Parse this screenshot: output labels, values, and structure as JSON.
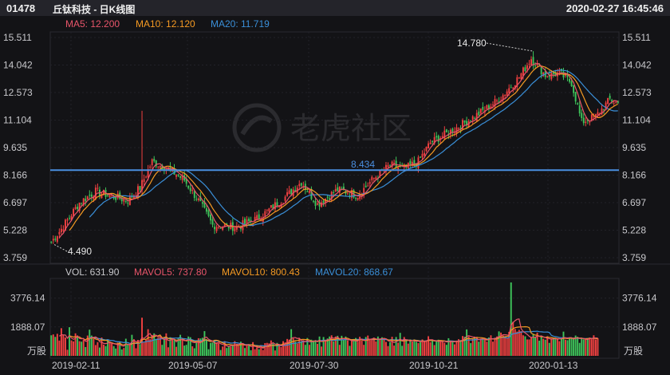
{
  "header": {
    "code": "01478",
    "name": "丘钛科技 - 日K线图",
    "datetime": "2020-02-27 16:45:46"
  },
  "watermark": {
    "text": "老虎社区"
  },
  "price_legend": {
    "ma5": "MA5: 12.200",
    "ma10": "MA10: 12.120",
    "ma20": "MA20: 11.719"
  },
  "volume_legend": {
    "vol": "VOL: 631.90",
    "mavol5": "MAVOL5: 737.80",
    "mavol10": "MAVOL10: 800.43",
    "mavol20": "MAVOL20: 868.67"
  },
  "volume_unit": "万股",
  "colors": {
    "up": "#f04040",
    "down": "#3ec45a",
    "ma5": "#e8556a",
    "ma10": "#f59a23",
    "ma20": "#3a8fd8",
    "hline": "#4a8fe0",
    "text": "#c8c8cc"
  },
  "chart_data": [
    {
      "type": "candlestick",
      "price_ticks": [
        "15.511",
        "14.042",
        "12.573",
        "11.104",
        "9.635",
        "8.166",
        "6.697",
        "5.228",
        "3.759"
      ],
      "ylim": [
        3.759,
        15.511
      ],
      "x_ticks": [
        "2019-02-11",
        "2019-05-07",
        "2019-07-30",
        "2019-10-21",
        "2020-01-13"
      ],
      "annotations": {
        "high": "14.780",
        "low": "4.490",
        "mid": "8.434"
      },
      "horizontal_line": 8.434,
      "anchors": [
        {
          "i": 0,
          "p": 4.6
        },
        {
          "i": 5,
          "p": 5.3
        },
        {
          "i": 14,
          "p": 6.7
        },
        {
          "i": 22,
          "p": 7.3
        },
        {
          "i": 38,
          "p": 6.8
        },
        {
          "i": 44,
          "p": 7.5
        },
        {
          "i": 50,
          "p": 8.9
        },
        {
          "i": 58,
          "p": 8.5
        },
        {
          "i": 66,
          "p": 7.9
        },
        {
          "i": 73,
          "p": 6.8
        },
        {
          "i": 80,
          "p": 5.5
        },
        {
          "i": 92,
          "p": 5.4
        },
        {
          "i": 103,
          "p": 5.9
        },
        {
          "i": 115,
          "p": 6.9
        },
        {
          "i": 124,
          "p": 7.8
        },
        {
          "i": 132,
          "p": 6.6
        },
        {
          "i": 142,
          "p": 7.4
        },
        {
          "i": 152,
          "p": 7.1
        },
        {
          "i": 160,
          "p": 8.0
        },
        {
          "i": 168,
          "p": 8.7
        },
        {
          "i": 175,
          "p": 8.5
        },
        {
          "i": 182,
          "p": 8.9
        },
        {
          "i": 188,
          "p": 9.9
        },
        {
          "i": 198,
          "p": 10.5
        },
        {
          "i": 210,
          "p": 11.3
        },
        {
          "i": 222,
          "p": 12.2
        },
        {
          "i": 232,
          "p": 13.4
        },
        {
          "i": 238,
          "p": 14.4
        },
        {
          "i": 245,
          "p": 13.5
        },
        {
          "i": 252,
          "p": 13.6
        },
        {
          "i": 258,
          "p": 13.1
        },
        {
          "i": 263,
          "p": 11.0
        },
        {
          "i": 270,
          "p": 11.3
        },
        {
          "i": 277,
          "p": 12.2
        },
        {
          "i": 281,
          "p": 12.0
        }
      ],
      "spikes": [
        {
          "i": 45,
          "high": 11.6
        },
        {
          "i": 239,
          "high": 14.78
        },
        {
          "i": 1,
          "low": 4.49
        }
      ]
    },
    {
      "type": "bar",
      "ticks": [
        "3776.14",
        "1888.07"
      ],
      "ylim": [
        0,
        4800
      ],
      "values": [
        1344,
        1400,
        1240,
        1440,
        1000,
        1808,
        1360,
        1200,
        400,
        1872,
        1008,
        944,
        1472,
        1264,
        960,
        928,
        1056,
        576,
        1328,
        1712,
        1328,
        1120,
        704,
        896,
        544,
        1200,
        736,
        640,
        1024,
        896,
        784,
        640,
        480,
        864,
        912,
        416,
        512,
        1120,
        800,
        784,
        1376,
        1088,
        496,
        1040,
        768,
        2496,
        880,
        1056,
        1744,
        1088,
        1360,
        1472,
        1104,
        1184,
        1216,
        720,
        1072,
        1472,
        560,
        1216,
        1152,
        1072,
        592,
        1152,
        1376,
        1168,
        672,
        720,
        1264,
        1216,
        624,
        496,
        864,
        1152,
        1136,
        1184,
        1616,
        1024,
        432,
        848,
        880,
        1024,
        880,
        832,
        384,
        608,
        960,
        512,
        624,
        608,
        704,
        960,
        784,
        640,
        928,
        736,
        512,
        720,
        688,
        368,
        896,
        432,
        560,
        432,
        704,
        384,
        832,
        848,
        816,
        1008,
        800,
        352,
        848,
        720,
        576,
        960,
        880,
        1104,
        1056,
        1744,
        1152,
        928,
        800,
        1152,
        944,
        1024,
        720,
        1168,
        720,
        1056,
        1008,
        1024,
        784,
        1264,
        608,
        1232,
        1024,
        1136,
        1264,
        1344,
        944,
        1264,
        1312,
        720,
        1312,
        1024,
        1264,
        1008,
        656,
        976,
        1104,
        1168,
        928,
        1248,
        992,
        720,
        1232,
        1328,
        1072,
        1136,
        1056,
        944,
        1264,
        1120,
        1216,
        1072,
        912,
        640,
        896,
        1248,
        672,
        1232,
        864,
        1504,
        656,
        1232,
        1008,
        800,
        1072,
        944,
        1072,
        912,
        832,
        896,
        1072,
        992,
        1024,
        1280,
        896,
        1072,
        704,
        960,
        1056,
        1024,
        896,
        864,
        720,
        1152,
        1008,
        960,
        752,
        960,
        1088,
        1040,
        1296,
        1248,
        1728,
        1264,
        832,
        1120,
        1184,
        1232,
        928,
        1056,
        1136,
        1072,
        928,
        1200,
        1344,
        928,
        1184,
        1264,
        1600,
        1520,
        1328,
        1200,
        1152,
        1568,
        4800,
        2224,
        1760,
        1584,
        1696,
        1616,
        1344,
        1280,
        1072,
        1072,
        1232,
        1440,
        1232,
        1520,
        992,
        1328,
        1120,
        1056,
        1280,
        848,
        1136,
        1200,
        1136,
        1152,
        960,
        1152,
        1584,
        1056,
        1024,
        1120,
        1152,
        1104,
        1328,
        1248,
        848,
        1184,
        1072,
        1104,
        1136,
        1200,
        1088,
        1344,
        1072,
        1152
      ]
    }
  ]
}
